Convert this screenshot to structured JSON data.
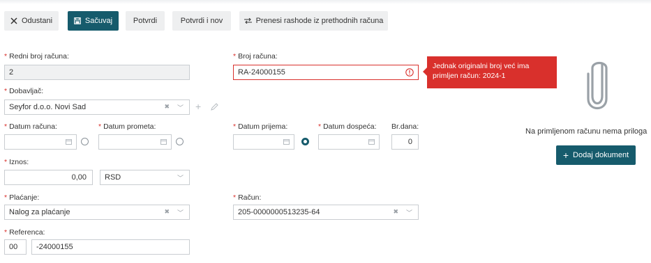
{
  "toolbar": {
    "cancel_label": "Odustani",
    "save_label": "Sačuvaj",
    "confirm_label": "Potvrdi",
    "confirm_new_label": "Potvrdi i nov",
    "transfer_label": "Prenesi rashode iz prethodnih računa"
  },
  "form": {
    "invoice_seq": {
      "label": "Redni broj računa:",
      "value": "2"
    },
    "invoice_number": {
      "label": "Broj računa:",
      "value": "RA-24000155",
      "error": "Jednak originalni broj već ima primljen račun: 2024-1"
    },
    "supplier": {
      "label": "Dobavljač:",
      "value": "Seyfor d.o.o. Novi Sad"
    },
    "invoice_date": {
      "label": "Datum računa:",
      "value": ""
    },
    "turnover_date": {
      "label": "Datum prometa:",
      "value": ""
    },
    "receipt_date": {
      "label": "Datum prijema:",
      "value": ""
    },
    "due_date": {
      "label": "Datum dospeća:",
      "value": ""
    },
    "days": {
      "label": "Br.dana:",
      "value": "0"
    },
    "amount": {
      "label": "Iznos:",
      "value": "0,00",
      "currency": "RSD"
    },
    "payment": {
      "label": "Plaćanje:",
      "value": "Nalog za plaćanje"
    },
    "account": {
      "label": "Račun:",
      "value": "205-0000000513235-64"
    },
    "reference": {
      "label": "Referenca:",
      "model": "00",
      "value": "-24000155"
    }
  },
  "attachments": {
    "empty_text": "Na primljenom računu nema priloga",
    "add_label": "Dodaj dokument"
  },
  "icons": {
    "cancel": "close-icon",
    "save": "save-icon",
    "transfer": "transfer-icon",
    "attachment": "paperclip-icon",
    "add": "plus-icon",
    "calendar": "calendar-icon",
    "error": "error-icon"
  },
  "colors": {
    "primary": "#165b6c",
    "error": "#d9302c"
  }
}
